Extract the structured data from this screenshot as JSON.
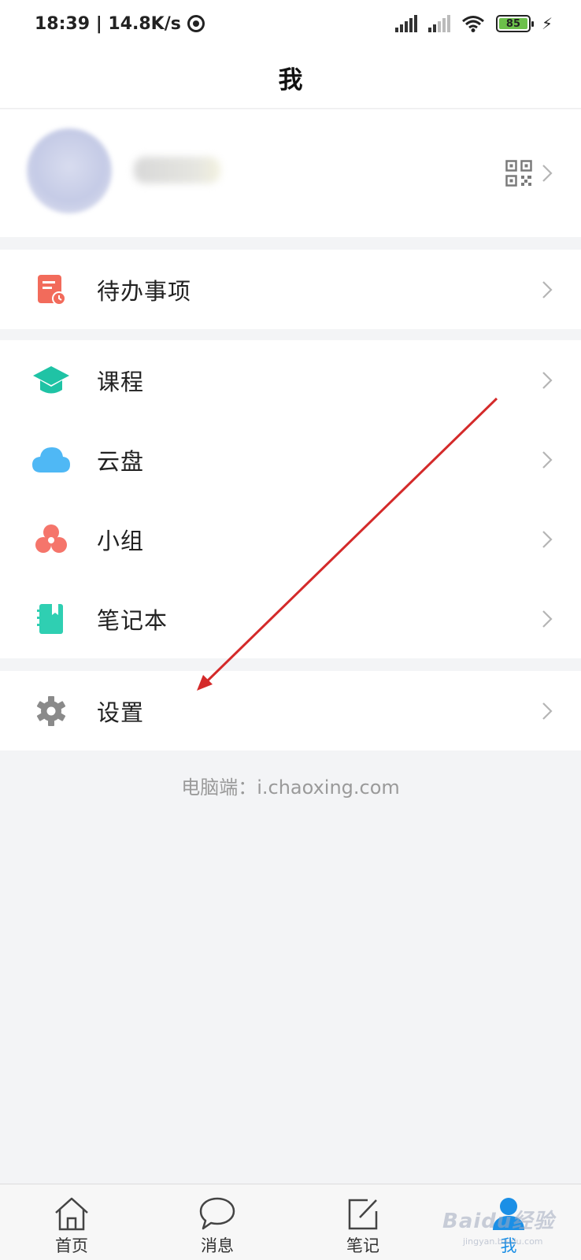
{
  "status_bar": {
    "time_speed": "18:39 | 14.8K/s",
    "battery": "85"
  },
  "header": {
    "title": "我"
  },
  "profile": {},
  "menu_sections": [
    {
      "items": [
        {
          "label": "待办事项",
          "icon": "todo-icon",
          "color": "#f26b5b"
        }
      ]
    },
    {
      "items": [
        {
          "label": "课程",
          "icon": "graduation-cap-icon",
          "color": "#1fc3a5"
        },
        {
          "label": "云盘",
          "icon": "cloud-icon",
          "color": "#4fb8f5"
        },
        {
          "label": "小组",
          "icon": "group-icon",
          "color": "#f5756b"
        },
        {
          "label": "笔记本",
          "icon": "notebook-icon",
          "color": "#2fcfb2"
        }
      ]
    },
    {
      "items": [
        {
          "label": "设置",
          "icon": "gear-icon",
          "color": "#8a8a8a"
        }
      ]
    }
  ],
  "footer": {
    "text": "电脑端：i.chaoxing.com"
  },
  "tabbar": {
    "tabs": [
      {
        "label": "首页",
        "icon": "home-icon"
      },
      {
        "label": "消息",
        "icon": "message-icon"
      },
      {
        "label": "笔记",
        "icon": "note-edit-icon"
      },
      {
        "label": "我",
        "icon": "user-icon",
        "active": true
      }
    ]
  },
  "watermark": {
    "brand": "Baidu经验",
    "url": "jingyan.baidu.com"
  },
  "colors": {
    "accent": "#1b8fe6",
    "annotation": "#d42a2a",
    "background": "#f3f4f6"
  }
}
